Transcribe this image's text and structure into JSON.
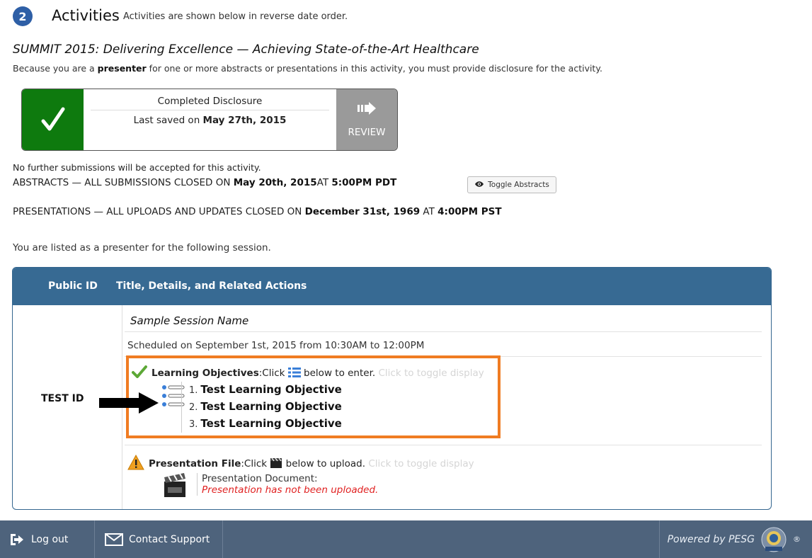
{
  "header": {
    "step_number": "2",
    "title": "Activities",
    "subtitle": "Activities are shown below in reverse date order."
  },
  "activity": {
    "title": "SUMMIT 2015: Delivering Excellence — Achieving State-of-the-Art Healthcare",
    "note_prefix": "Because you are a ",
    "note_role": "presenter",
    "note_suffix": " for one or more abstracts or presentations in this activity, you must provide disclosure for the activity."
  },
  "disclosure": {
    "heading": "Completed Disclosure",
    "saved_prefix": "Last saved on ",
    "saved_date": "May 27th, 2015",
    "review_label": "REVIEW",
    "check_icon": "checkmark-icon",
    "colors": {
      "complete": "#0e7a0e",
      "review": "#9a9a9a"
    }
  },
  "submissions": {
    "no_further": "No further submissions will be accepted for this activity.",
    "abstracts_label": "ABSTRACTS",
    "abstracts_text": " — ALL SUBMISSIONS CLOSED ON ",
    "abstracts_date": "May 20th, 2015",
    "abstracts_at": "AT ",
    "abstracts_time": "5:00PM PDT",
    "toggle_abstracts": "Toggle Abstracts",
    "presentations_label": "PRESENTATIONS",
    "presentations_text": " — ALL UPLOADS AND UPDATES CLOSED ON ",
    "presentations_date": "December 31st, 1969",
    "presentations_at": " AT ",
    "presentations_time": "4:00PM PST"
  },
  "listed_text": "You are listed as a presenter for the following session.",
  "session_table": {
    "col_public_id": "Public ID",
    "col_title": "Title, Details, and Related Actions",
    "public_id": "TEST ID",
    "session_name": "Sample Session Name",
    "scheduled": "Scheduled on September 1st, 2015 from 10:30AM to 12:00PM",
    "lo_label": "Learning Objectives",
    "lo_click": ":Click ",
    "lo_after": " below to enter. ",
    "lo_toggle": "Click to toggle display",
    "objectives": [
      {
        "num": "1.",
        "text": "Test Learning Objective"
      },
      {
        "num": "2.",
        "text": "Test Learning Objective"
      },
      {
        "num": "3.",
        "text": "Test Learning Objective"
      }
    ],
    "pf_label": "Presentation File",
    "pf_click": ":Click ",
    "pf_after": " below to upload. ",
    "pf_toggle": "Click to toggle display",
    "pf_doc_label": "Presentation Document:",
    "pf_doc_status": "Presentation has not been uploaded.",
    "colors": {
      "header": "#376a93",
      "highlight": "#f07c22",
      "error": "#e02020"
    }
  },
  "footer": {
    "logout": "Log out",
    "contact": "Contact Support",
    "powered": "Powered by PESG",
    "registered": "®"
  }
}
